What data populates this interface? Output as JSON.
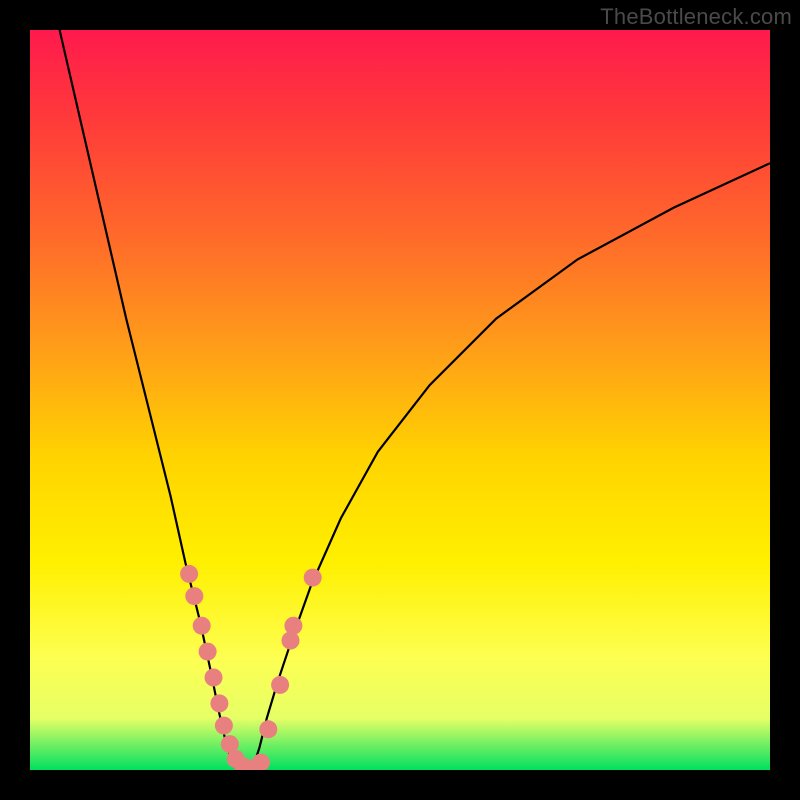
{
  "watermark": "TheBottleneck.com",
  "chart_data": {
    "type": "line",
    "title": "",
    "xlabel": "",
    "ylabel": "",
    "xlim": [
      0,
      1
    ],
    "ylim": [
      0,
      1
    ],
    "curve_left": {
      "name": "left-branch",
      "x": [
        0.04,
        0.07,
        0.1,
        0.13,
        0.16,
        0.19,
        0.21,
        0.23,
        0.245,
        0.255,
        0.263,
        0.27,
        0.28
      ],
      "y": [
        1.0,
        0.87,
        0.74,
        0.61,
        0.49,
        0.37,
        0.28,
        0.2,
        0.13,
        0.08,
        0.045,
        0.02,
        0.0
      ]
    },
    "curve_right": {
      "name": "right-branch",
      "x": [
        0.3,
        0.31,
        0.32,
        0.335,
        0.355,
        0.38,
        0.42,
        0.47,
        0.54,
        0.63,
        0.74,
        0.87,
        1.0
      ],
      "y": [
        0.0,
        0.03,
        0.07,
        0.12,
        0.18,
        0.25,
        0.34,
        0.43,
        0.52,
        0.61,
        0.69,
        0.76,
        0.82
      ]
    },
    "valley_floor": {
      "x": [
        0.28,
        0.3
      ],
      "y": [
        0.0,
        0.0
      ]
    },
    "points": {
      "name": "markers",
      "color": "#e98080",
      "x": [
        0.215,
        0.222,
        0.232,
        0.24,
        0.248,
        0.256,
        0.262,
        0.27,
        0.278,
        0.288,
        0.3,
        0.312,
        0.322,
        0.338,
        0.352,
        0.356,
        0.382
      ],
      "y": [
        0.265,
        0.235,
        0.195,
        0.16,
        0.125,
        0.09,
        0.06,
        0.035,
        0.015,
        0.005,
        0.002,
        0.01,
        0.055,
        0.115,
        0.175,
        0.195,
        0.26
      ]
    }
  },
  "colors": {
    "curve": "#000000",
    "marker_fill": "#e98080",
    "marker_stroke": "#c95f5f"
  }
}
